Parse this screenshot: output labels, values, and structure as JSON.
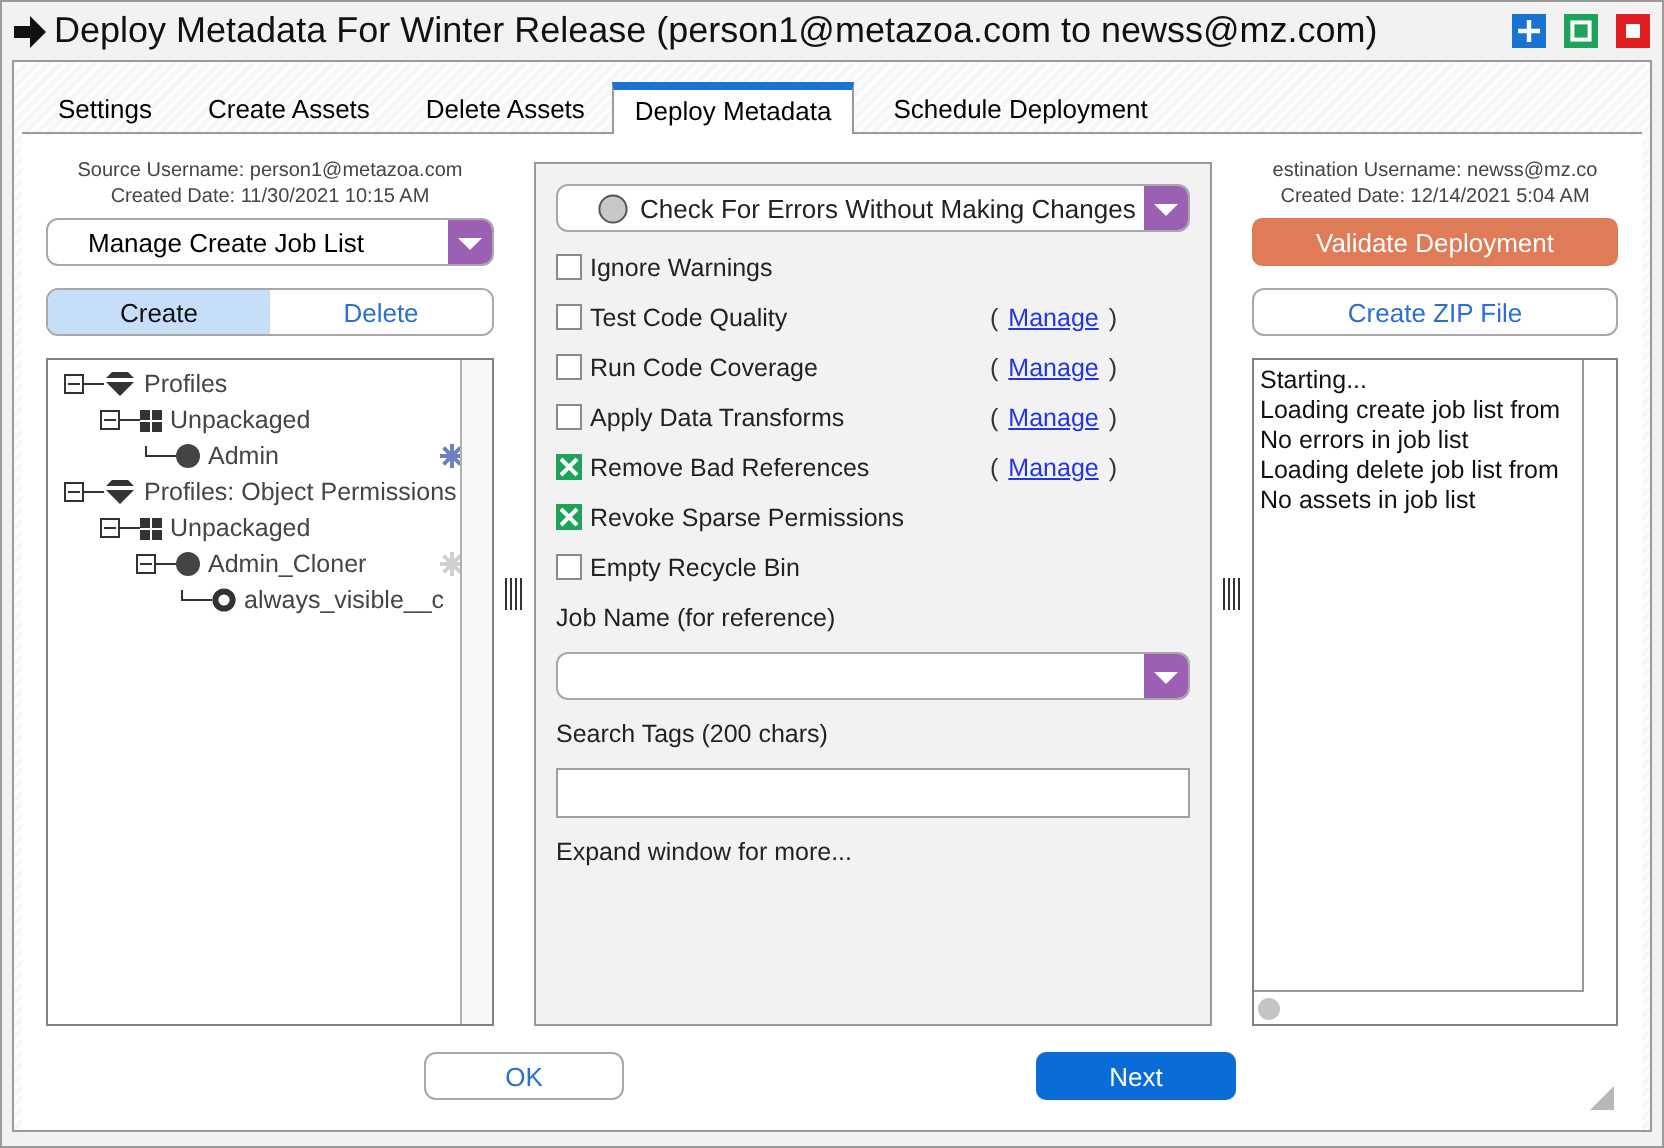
{
  "window": {
    "title": "Deploy Metadata For Winter Release (person1@metazoa.com to newss@mz.com)"
  },
  "tabs": [
    {
      "label": "Settings",
      "selected": false
    },
    {
      "label": "Create Assets",
      "selected": false
    },
    {
      "label": "Delete Assets",
      "selected": false
    },
    {
      "label": "Deploy Metadata",
      "selected": true
    },
    {
      "label": "Schedule Deployment",
      "selected": false
    }
  ],
  "source": {
    "username": "Source Username: person1@metazoa.com",
    "created": "Created Date: 11/30/2021 10:15 AM",
    "dropdown": "Manage Create Job List",
    "segments": [
      {
        "label": "Create",
        "selected": true
      },
      {
        "label": "Delete",
        "selected": false
      }
    ],
    "tree": [
      {
        "label": "Profiles",
        "kind": "group",
        "expanded": true,
        "children": [
          {
            "label": "Unpackaged",
            "kind": "package",
            "expanded": true,
            "children": [
              {
                "label": "Admin",
                "kind": "profile",
                "marker_active": true
              }
            ]
          }
        ]
      },
      {
        "label": "Profiles: Object Permissions",
        "kind": "group",
        "expanded": true,
        "children": [
          {
            "label": "Unpackaged",
            "kind": "package",
            "expanded": true,
            "children": [
              {
                "label": "Admin_Cloner",
                "kind": "profile",
                "marker_active": false,
                "expanded": true,
                "children": [
                  {
                    "label": "always_visible__c",
                    "kind": "field"
                  }
                ]
              }
            ]
          }
        ]
      }
    ]
  },
  "options": {
    "mode": "Check For Errors Without Making Changes",
    "checks": [
      {
        "label": "Ignore Warnings",
        "checked": false
      },
      {
        "label": "Test Code Quality",
        "checked": false,
        "link": {
          "before": "(",
          "text": "Manage",
          "after": ")"
        }
      },
      {
        "label": "Run Code Coverage",
        "checked": false,
        "link": {
          "before": "(",
          "text": "Manage",
          "after": ")"
        }
      },
      {
        "label": "Apply Data Transforms",
        "checked": false,
        "link": {
          "before": "(",
          "text": "Manage",
          "after": ")"
        }
      },
      {
        "label": "Remove Bad References",
        "checked": true,
        "link": {
          "before": "(",
          "text": "Manage",
          "after": ")"
        }
      },
      {
        "label": "Revoke Sparse Permissions",
        "checked": true
      },
      {
        "label": "Empty Recycle Bin",
        "checked": false
      }
    ],
    "job_name_label": "Job Name (for reference)",
    "search_tags_label": "Search Tags (200 chars)",
    "hint": "Expand window for more..."
  },
  "destination": {
    "username": "estination Username: newss@mz.co",
    "created": "Created Date: 12/14/2021 5:04 AM",
    "validate": "Validate Deployment",
    "zip": "Create ZIP File",
    "log": [
      "Starting...",
      "Loading create job list from",
      "No errors in job list",
      "Loading delete job list from",
      "No assets in job list"
    ]
  },
  "buttons": {
    "ok": "OK",
    "next": "Next"
  }
}
